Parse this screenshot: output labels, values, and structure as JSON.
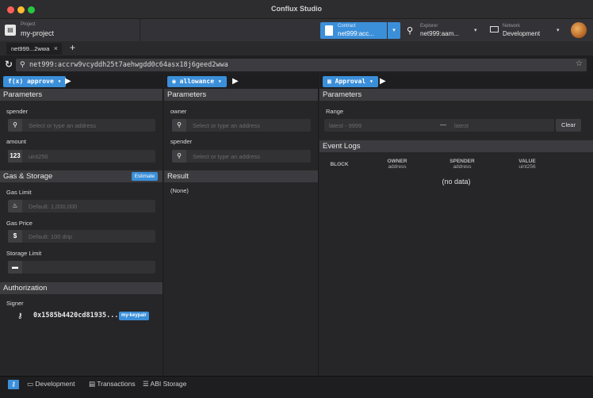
{
  "window": {
    "title": "Conflux Studio"
  },
  "header": {
    "project_label": "Project",
    "project_name": "my-project",
    "contract_label": "Contract",
    "contract_value": "net999:acc...",
    "explorer_label": "Explorer",
    "explorer_value": "net999:aam...",
    "network_label": "Network",
    "network_value": "Development"
  },
  "tabs": [
    {
      "label": "net999...2wwa"
    }
  ],
  "address_bar": {
    "value": "net999:accrw9vcyddh25t7aehwgdd0c64asx18j6geed2wwa"
  },
  "col1": {
    "method": "approve",
    "method_prefix": "f(x)",
    "parameters_title": "Parameters",
    "spender_label": "spender",
    "spender_placeholder": "Select or type an address",
    "amount_label": "amount",
    "amount_icon": "123",
    "amount_placeholder": "uint256",
    "gas_title": "Gas & Storage",
    "estimate_label": "Estimate",
    "gas_limit_label": "Gas Limit",
    "gas_limit_placeholder": "Default: 1,000,000",
    "gas_price_label": "Gas Price",
    "gas_price_icon": "$",
    "gas_price_placeholder": "Default: 100 drip",
    "storage_limit_label": "Storage Limit",
    "authorization_title": "Authorization",
    "signer_label": "Signer",
    "signer_value": "0x1585b4420cd81935...",
    "signer_badge": "my-keypair"
  },
  "col2": {
    "method": "allowance",
    "parameters_title": "Parameters",
    "owner_label": "owner",
    "owner_placeholder": "Select or type an address",
    "spender_label": "spender",
    "spender_placeholder": "Select or type an address",
    "result_title": "Result",
    "result_value": "(None)"
  },
  "col3": {
    "event": "Approval",
    "parameters_title": "Parameters",
    "range_label": "Range",
    "range_from": "latest - 9999",
    "range_sep": "—",
    "range_to": "latest",
    "clear_label": "Clear",
    "event_logs_title": "Event Logs",
    "columns": [
      {
        "name": "BLOCK",
        "type": ""
      },
      {
        "name": "OWNER",
        "type": "address"
      },
      {
        "name": "SPENDER",
        "type": "address"
      },
      {
        "name": "VALUE",
        "type": "uint256"
      }
    ],
    "no_data": "(no data)"
  },
  "statusbar": {
    "development": "Development",
    "transactions": "Transactions",
    "abi_storage": "ABI Storage"
  },
  "colors": {
    "accent": "#3b8fd9",
    "background": "#262628"
  }
}
